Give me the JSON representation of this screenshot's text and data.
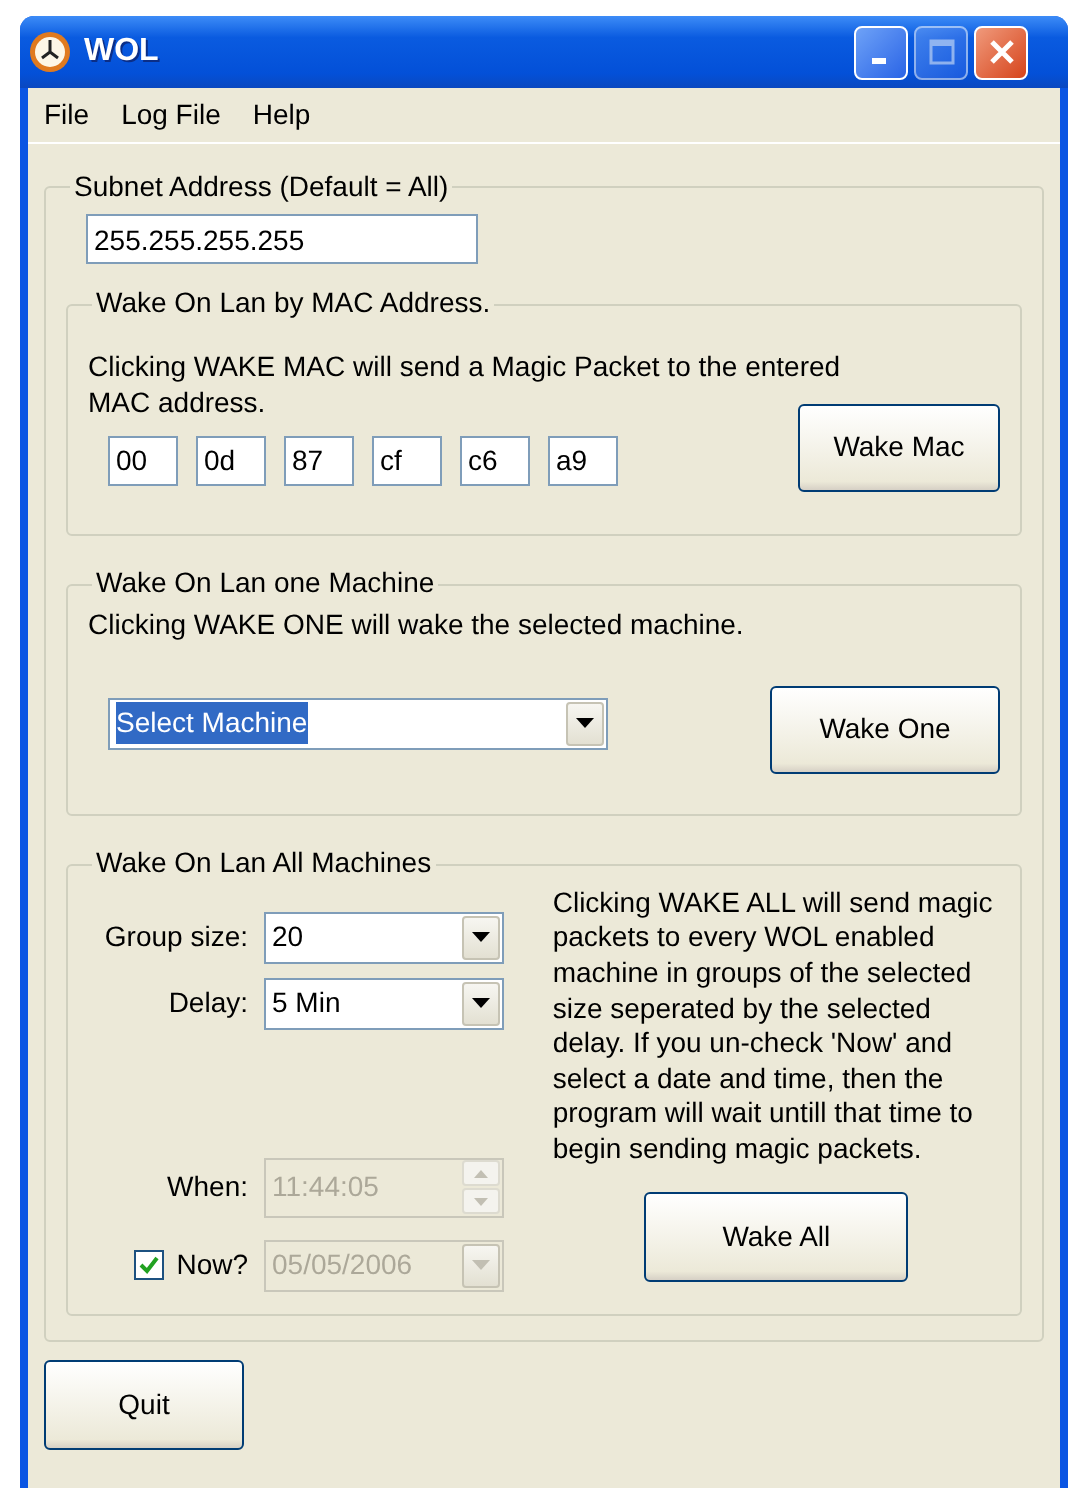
{
  "window": {
    "title": "WOL"
  },
  "menu": [
    "File",
    "Log File",
    "Help"
  ],
  "subnet": {
    "legend": "Subnet Address (Default = All)",
    "value": "255.255.255.255"
  },
  "mac": {
    "legend": "Wake On Lan by MAC Address.",
    "description": "Clicking WAKE MAC will send a Magic Packet to the entered MAC address.",
    "octets": [
      "00",
      "0d",
      "87",
      "cf",
      "c6",
      "a9"
    ],
    "button": "Wake Mac"
  },
  "one": {
    "legend": "Wake On Lan one Machine",
    "description": "Clicking WAKE ONE will wake the selected machine.",
    "machine": {
      "value": "Select Machine",
      "selected": true
    },
    "button": "Wake One"
  },
  "all": {
    "legend": "Wake On Lan All Machines",
    "fields": [
      {
        "label": "Group size:",
        "value": "20",
        "kind": "dropdown",
        "disabled": false
      },
      {
        "label": "Delay:",
        "value": "5 Min",
        "kind": "dropdown",
        "disabled": false
      },
      {
        "label": "When:",
        "value": "11:44:05",
        "kind": "spinner",
        "disabled": true
      },
      {
        "label": "Now?",
        "value": "05/05/2006",
        "kind": "dropdown",
        "disabled": true,
        "checked": true
      }
    ],
    "description": "Clicking WAKE ALL will send magic packets to every WOL enabled machine in groups of the selected size seperated by the selected delay. If you un-check 'Now' and select a date and time, then the program will wait untill that time to begin sending magic packets.",
    "button": "Wake All"
  },
  "quit": "Quit"
}
